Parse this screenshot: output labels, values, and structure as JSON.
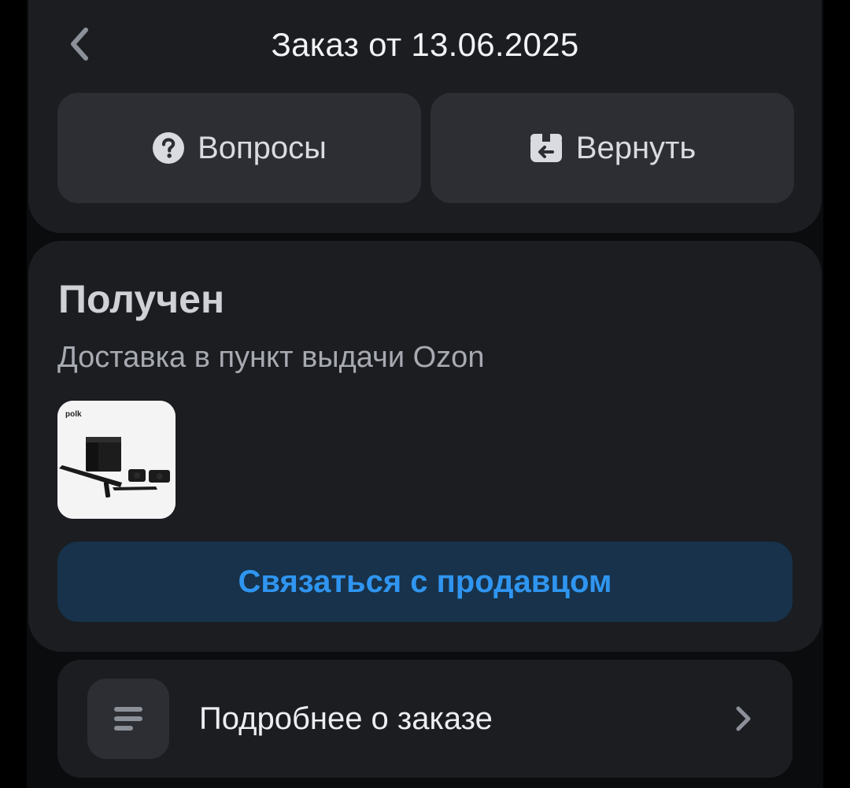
{
  "header": {
    "title": "Заказ от 13.06.2025",
    "back_icon": "chevron-left-icon"
  },
  "actions": {
    "questions_label": "Вопросы",
    "questions_icon": "question-circle-icon",
    "return_label": "Вернуть",
    "return_icon": "return-box-icon"
  },
  "status": {
    "title": "Получен",
    "subtitle": "Доставка в пункт выдачи Ozon",
    "product_brand": "polk",
    "contact_label": "Связаться с продавцом"
  },
  "details": {
    "label": "Подробнее о заказе",
    "icon": "lines-icon",
    "chevron_icon": "chevron-right-icon"
  },
  "colors": {
    "background": "#000000",
    "card": "#1b1d21",
    "button": "#2c2e33",
    "accent_blue": "#2f95f0",
    "accent_blue_bg": "#17324a"
  }
}
